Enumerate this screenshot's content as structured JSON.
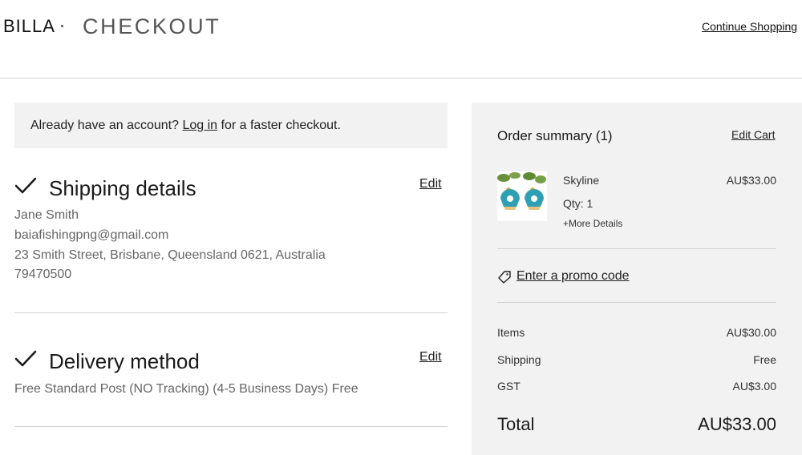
{
  "header": {
    "logo_text": "BILLA",
    "title": "CHECKOUT",
    "continue_label": "Continue Shopping"
  },
  "login_banner": {
    "prefix": "Already have an account?",
    "link": "Log in",
    "suffix": "for a faster checkout."
  },
  "shipping": {
    "title": "Shipping details",
    "edit_label": "Edit",
    "name": "Jane Smith",
    "email": "baiafishingpng@gmail.com",
    "address": "23 Smith Street, Brisbane, Queensland 0621, Australia",
    "phone": "79470500"
  },
  "delivery": {
    "title": "Delivery method",
    "edit_label": "Edit",
    "method": "Free Standard Post (NO Tracking) (4-5 Business Days) Free"
  },
  "summary": {
    "title": "Order summary (1)",
    "edit_cart_label": "Edit Cart",
    "item": {
      "name": "Skyline",
      "price": "AU$33.00",
      "qty": "Qty: 1",
      "more": "+More Details"
    },
    "promo_label": "Enter a promo code",
    "rows": [
      {
        "label": "Items",
        "value": "AU$30.00"
      },
      {
        "label": "Shipping",
        "value": "Free"
      },
      {
        "label": "GST",
        "value": "AU$3.00"
      }
    ],
    "total_label": "Total",
    "total_value": "AU$33.00"
  },
  "icons": {
    "check": "checkmark-icon",
    "promo": "tag-icon"
  },
  "colors": {
    "panel_bg": "#f2f2f2",
    "muted_text": "#666666",
    "divider": "#d4d4d4"
  }
}
